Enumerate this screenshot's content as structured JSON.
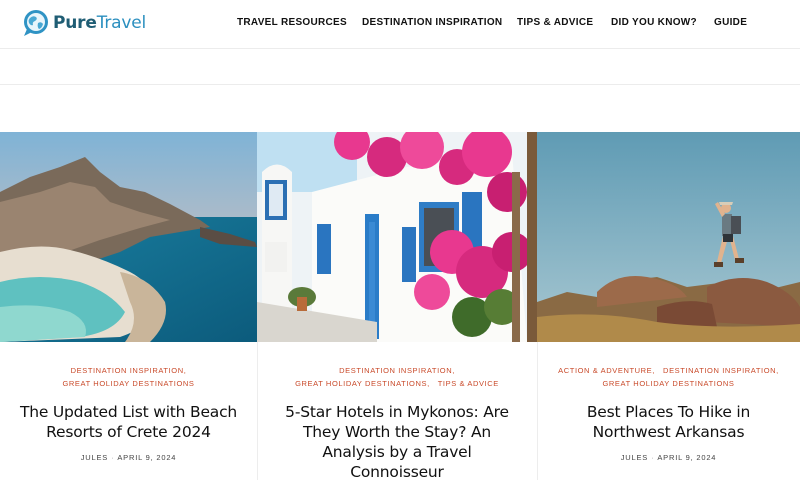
{
  "brand": {
    "name_part1": "Pure",
    "name_part2": "Travel"
  },
  "nav": [
    {
      "label": "TRAVEL RESOURCES"
    },
    {
      "label": "DESTINATION INSPIRATION"
    },
    {
      "label": "TIPS & ADVICE"
    },
    {
      "label": "DID YOU KNOW?"
    },
    {
      "label": "GUIDE"
    }
  ],
  "colors": {
    "accent": "#c94a2a",
    "brand_dark": "#1f5d74",
    "brand_light": "#2b8fbf"
  },
  "posts": [
    {
      "categories": [
        "DESTINATION INSPIRATION",
        "GREAT HOLIDAY DESTINATIONS"
      ],
      "title_lines": [
        "The Updated List with Beach",
        "Resorts of Crete 2024"
      ],
      "author": "JULES",
      "date": "APRIL 9, 2024",
      "image": "crete-balos-lagoon-photo"
    },
    {
      "categories": [
        "DESTINATION INSPIRATION",
        "GREAT HOLIDAY DESTINATIONS",
        "TIPS & ADVICE"
      ],
      "title_lines": [
        "5-Star Hotels in Mykonos: Are",
        "They Worth the Stay? An",
        "Analysis by a Travel",
        "Connoisseur"
      ],
      "image": "mykonos-whitewashed-street-photo"
    },
    {
      "categories": [
        "ACTION & ADVENTURE",
        "DESTINATION INSPIRATION",
        "GREAT HOLIDAY DESTINATIONS"
      ],
      "title_lines": [
        "Best Places To Hike in",
        "Northwest Arkansas"
      ],
      "author": "JULES",
      "date": "APRIL 9, 2024",
      "image": "hiker-on-rocks-photo"
    }
  ]
}
